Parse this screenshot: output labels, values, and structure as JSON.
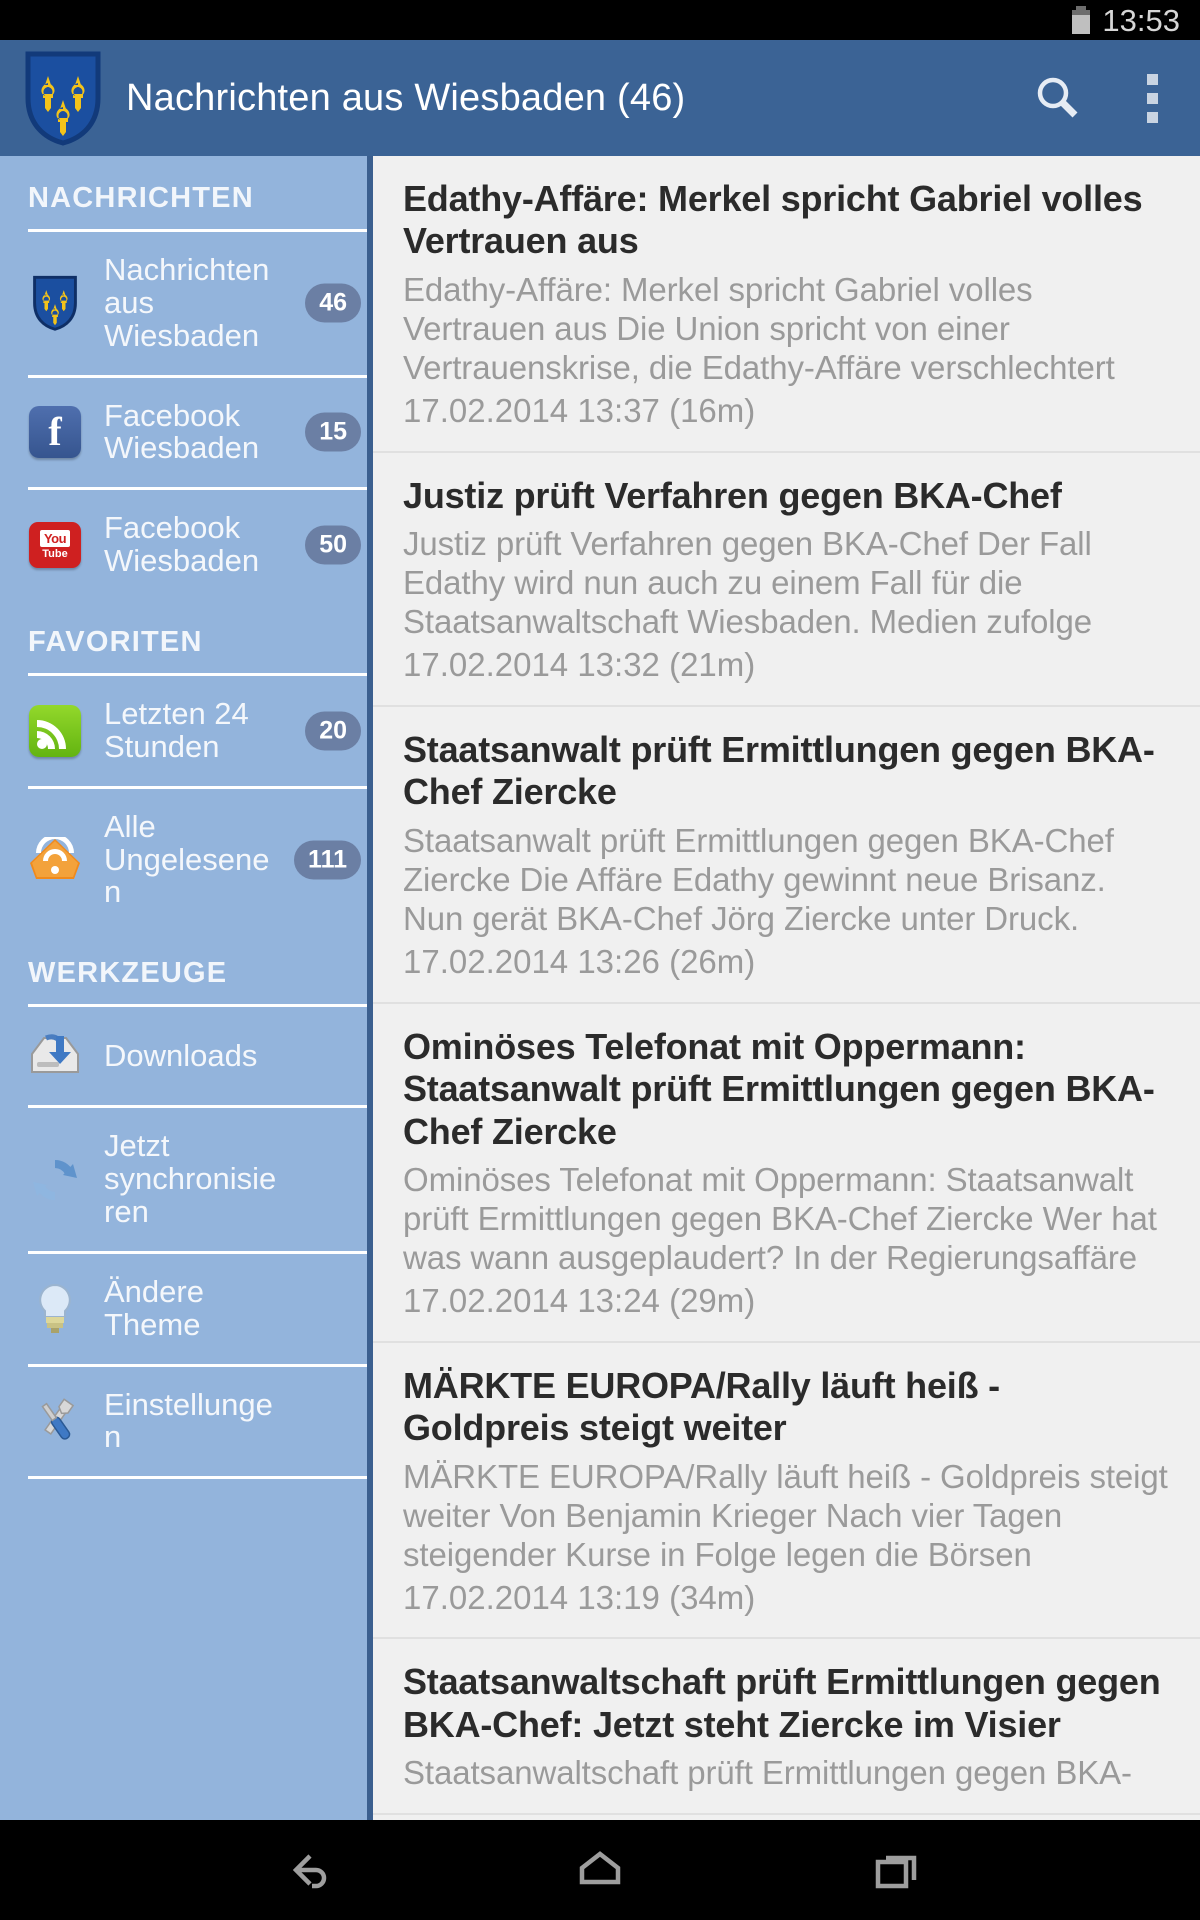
{
  "status_bar": {
    "time": "13:53",
    "battery_icon": "battery-icon"
  },
  "action_bar": {
    "app_icon": "wiesbaden-crest-icon",
    "title": "Nachrichten aus Wiesbaden (46)",
    "search_icon": "search-icon",
    "overflow_icon": "overflow-menu-icon"
  },
  "drawer": {
    "sections": [
      {
        "heading": "NACHRICHTEN",
        "items": [
          {
            "icon": "wiesbaden-crest-icon",
            "label": "Nachrichten aus Wiesbaden",
            "badge": "46"
          },
          {
            "icon": "facebook-icon",
            "label": "Facebook Wiesbaden",
            "badge": "15"
          },
          {
            "icon": "youtube-icon",
            "label": "Facebook Wiesbaden",
            "badge": "50"
          }
        ]
      },
      {
        "heading": "FAVORITEN",
        "items": [
          {
            "icon": "rss-feed-icon",
            "label": "Letzten 24 Stunden",
            "badge": "20"
          },
          {
            "icon": "rss-orange-icon",
            "label": "Alle Ungelesenen",
            "badge": "111"
          }
        ]
      },
      {
        "heading": "WERKZEUGE",
        "items": [
          {
            "icon": "downloads-icon",
            "label": "Downloads",
            "badge": ""
          },
          {
            "icon": "sync-icon",
            "label": "Jetzt synchronisieren",
            "badge": ""
          },
          {
            "icon": "lightbulb-icon",
            "label": "Ändere Theme",
            "badge": ""
          },
          {
            "icon": "tools-icon",
            "label": "Einstellungen",
            "badge": ""
          }
        ]
      }
    ]
  },
  "articles": [
    {
      "title": "Edathy-Affäre: Merkel spricht Gabriel volles Vertrauen aus",
      "snippet": "Edathy-Affäre: Merkel spricht Gabriel volles Vertrauen aus Die Union spricht von einer Vertrauenskrise, die Edathy-Affäre verschlechtert",
      "date": "17.02.2014 13:37 (16m)"
    },
    {
      "title": "Justiz prüft Verfahren gegen BKA-Chef",
      "snippet": "Justiz prüft Verfahren gegen BKA-Chef Der Fall Edathy wird nun auch zu einem Fall für die Staatsanwaltschaft Wiesbaden. Medien zufolge",
      "date": "17.02.2014 13:32 (21m)"
    },
    {
      "title": "Staatsanwalt prüft Ermittlungen gegen BKA-Chef Ziercke",
      "snippet": "Staatsanwalt prüft Ermittlungen gegen BKA-Chef Ziercke Die Affäre Edathy gewinnt neue Brisanz. Nun gerät BKA-Chef Jörg Ziercke unter Druck.",
      "date": "17.02.2014 13:26 (26m)"
    },
    {
      "title": "Ominöses Telefonat mit Oppermann: Staatsanwalt prüft Ermittlungen gegen BKA-Chef Ziercke",
      "snippet": "Ominöses Telefonat mit Oppermann: Staatsanwalt prüft Ermittlungen gegen BKA-Chef Ziercke Wer hat was wann ausgeplaudert? In der Regierungsaffäre",
      "date": "17.02.2014 13:24 (29m)"
    },
    {
      "title": "MÄRKTE EUROPA/Rally läuft heiß - Goldpreis steigt weiter",
      "snippet": "MÄRKTE EUROPA/Rally läuft heiß - Goldpreis steigt weiter   Von Benjamin Krieger   Nach vier Tagen steigender Kurse in Folge legen die Börsen",
      "date": "17.02.2014 13:19 (34m)"
    },
    {
      "title": "Staatsanwaltschaft prüft Ermittlungen gegen BKA-Chef: Jetzt steht Ziercke im Visier",
      "snippet": "Staatsanwaltschaft prüft Ermittlungen gegen BKA-",
      "date": ""
    }
  ],
  "nav_bar": {
    "back_icon": "back-icon",
    "home_icon": "home-icon",
    "recents_icon": "recent-apps-icon"
  },
  "colors": {
    "action_bar": "#3b6395",
    "drawer": "#93b4dc",
    "drawer_border": "#3b5f8f",
    "list_background": "#f0f0f0",
    "title_text": "#2b2b2b",
    "snippet_text": "#9a9a9a",
    "badge": "#6b7fa4"
  }
}
